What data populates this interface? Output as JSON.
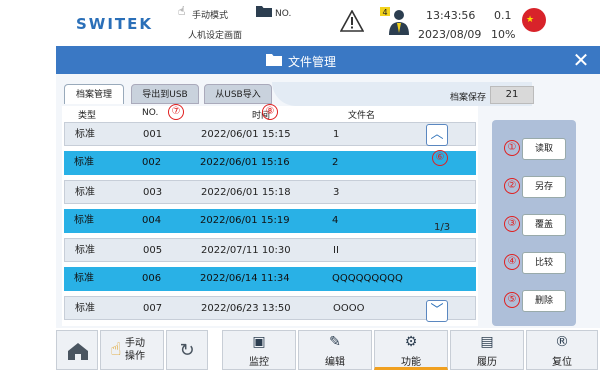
{
  "header": {
    "logo": "SWITEK",
    "mode_label": "手动模式",
    "screen_label": "人机设定画面",
    "no_label": "NO.",
    "time": "13:43:56",
    "date": "2023/08/09",
    "version": "0.1",
    "percent": "10%",
    "operator_badge": "4"
  },
  "dialog": {
    "title": "文件管理",
    "close_label": "✕",
    "tabs": [
      {
        "label": "档案管理"
      },
      {
        "label": "导出到USB"
      },
      {
        "label": "从USB导入"
      }
    ],
    "save_label": "档案保存",
    "save_count": "21",
    "columns": {
      "type": "类型",
      "no": "NO.",
      "time": "时间",
      "name": "文件名"
    },
    "rows": [
      {
        "type": "标准",
        "no": "001",
        "time": "2022/06/01 15:15",
        "name": "1"
      },
      {
        "type": "标准",
        "no": "002",
        "time": "2022/06/01 15:16",
        "name": "2"
      },
      {
        "type": "标准",
        "no": "003",
        "time": "2022/06/01 15:18",
        "name": "3"
      },
      {
        "type": "标准",
        "no": "004",
        "time": "2022/06/01 15:19",
        "name": "4"
      },
      {
        "type": "标准",
        "no": "005",
        "time": "2022/07/11 10:30",
        "name": "II"
      },
      {
        "type": "标准",
        "no": "006",
        "time": "2022/06/14 11:34",
        "name": "QQQQQQQQQ"
      },
      {
        "type": "标准",
        "no": "007",
        "time": "2022/06/23 13:50",
        "name": "OOOO"
      }
    ],
    "page_indicator": "1/3",
    "actions": {
      "read": "读取",
      "save_as": "另存",
      "overwrite": "覆盖",
      "compare": "比较",
      "delete": "删除"
    },
    "marks": [
      "①",
      "②",
      "③",
      "④",
      "⑤",
      "⑥",
      "⑦",
      "⑧"
    ]
  },
  "footer": {
    "manual": "手动\n操作",
    "monitor": "监控",
    "edit": "编辑",
    "function": "功能",
    "history": "履历",
    "reset": "复位"
  },
  "colors": {
    "dialog_bg": "#3a78c4",
    "row_highlight": "#29b1e6",
    "row_normal": "#e4eaf1",
    "mark_red": "#e02020",
    "active_underline": "#f0a020"
  }
}
